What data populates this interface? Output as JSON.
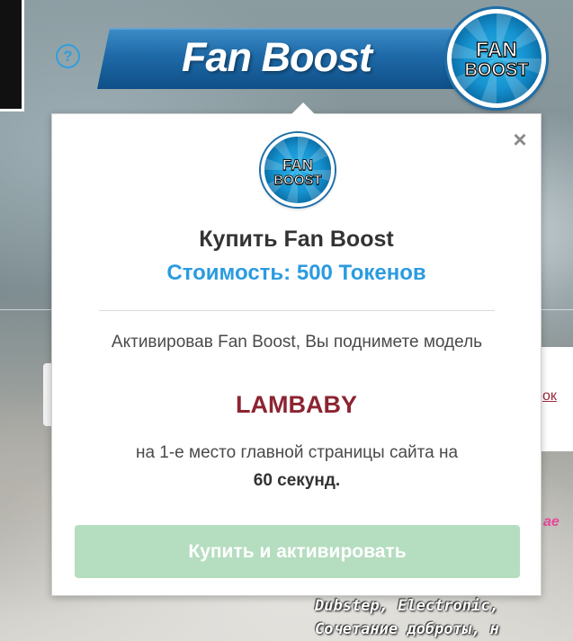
{
  "header": {
    "banner_title": "Fan Boost",
    "help_icon": "question-circle-icon",
    "help_symbol": "?"
  },
  "logo": {
    "line1": "FAN",
    "line2": "BOOST"
  },
  "popup": {
    "close_symbol": "×",
    "title": "Купить Fan Boost",
    "price": "Стоимость: 500 Токенов",
    "description_line1": "Активировав Fan Boost, Вы поднимете модель",
    "model_name": "LAMBABY",
    "description_line2": "на 1-е место главной страницы сайта на",
    "duration": "60 секунд.",
    "buy_button_label": "Купить и активировать"
  },
  "background": {
    "link_fragment": "ок",
    "pink_fragment": "ае",
    "chat_line1": "Dubstep, Electronic,",
    "chat_line2": "Сочетание доброты, н"
  },
  "colors": {
    "banner_blue": "#1e6aa8",
    "price_blue": "#2b9be0",
    "model_red": "#8c2432",
    "button_green_disabled": "#b5ddbf",
    "help_blue": "#2f9fdd"
  }
}
